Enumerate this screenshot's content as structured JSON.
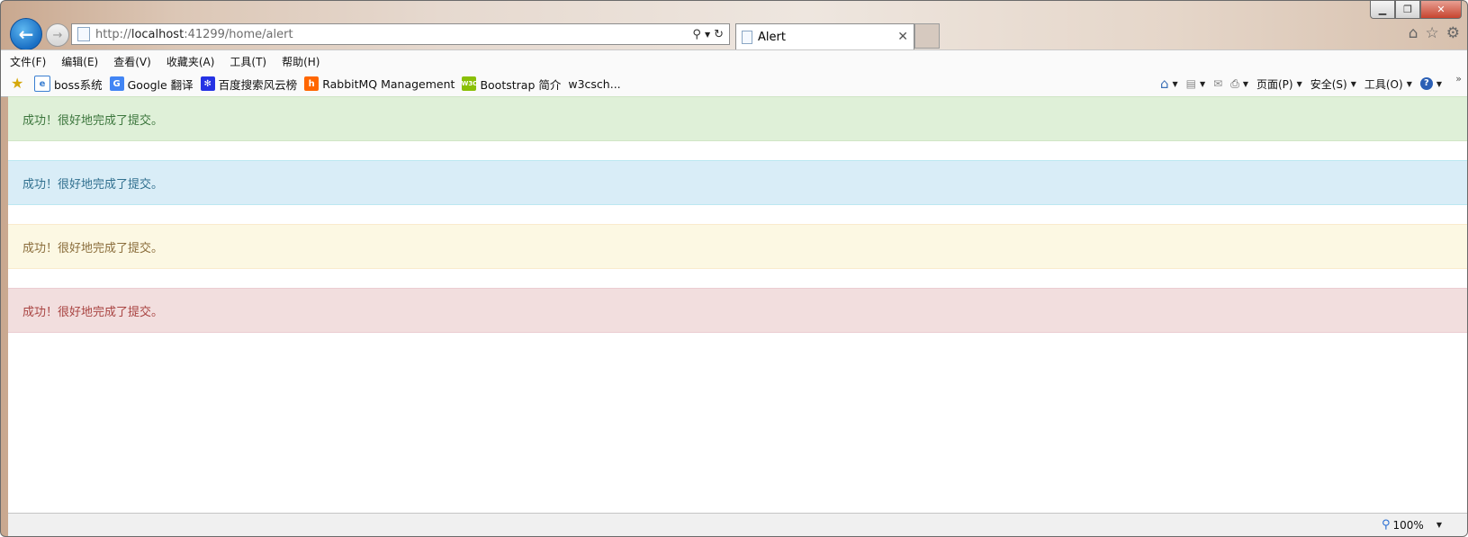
{
  "browser": {
    "url": {
      "prefix": "http://",
      "host": "localhost",
      "rest": ":41299/home/alert"
    },
    "tab": {
      "title": "Alert"
    },
    "menu": [
      "文件(F)",
      "编辑(E)",
      "查看(V)",
      "收藏夹(A)",
      "工具(T)",
      "帮助(H)"
    ],
    "favorites": [
      {
        "label": "boss系统",
        "icon": "page-icon",
        "color": "#3b7fd1"
      },
      {
        "label": "Google 翻译",
        "icon": "google-translate-icon",
        "color": "#4285f4"
      },
      {
        "label": "百度搜索风云榜",
        "icon": "baidu-paw-icon",
        "color": "#2532e4"
      },
      {
        "label": "RabbitMQ Management",
        "icon": "rabbitmq-icon",
        "color": "#f60"
      },
      {
        "label": "Bootstrap 简介",
        "icon": "w3c-icon",
        "color": "#8ac007"
      },
      {
        "label": "w3csch...",
        "icon": "none",
        "color": ""
      }
    ],
    "commands": {
      "page": "页面(P)",
      "safety": "安全(S)",
      "tools": "工具(O)"
    },
    "status": {
      "zoom": "100%"
    }
  },
  "alerts": [
    {
      "type": "success",
      "text": "成功！很好地完成了提交。"
    },
    {
      "type": "info",
      "text": "成功！很好地完成了提交。"
    },
    {
      "type": "warning",
      "text": "成功！很好地完成了提交。"
    },
    {
      "type": "danger",
      "text": "成功！很好地完成了提交。"
    }
  ]
}
